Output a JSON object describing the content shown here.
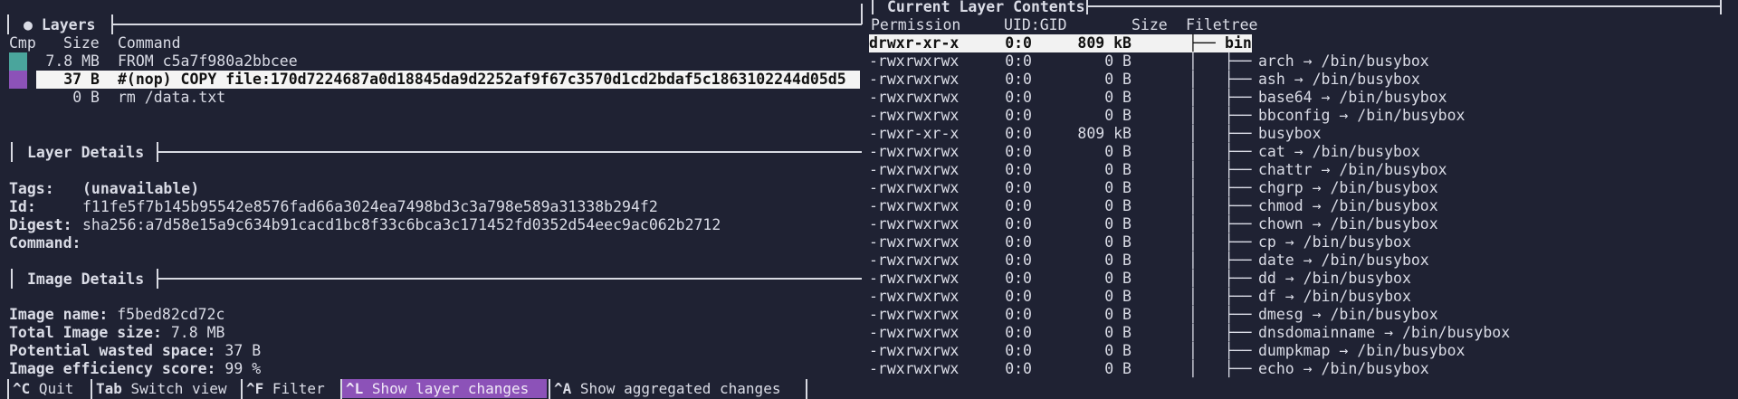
{
  "layers_panel": {
    "title": "● Layers",
    "headers": {
      "cmp": "Cmp",
      "size": "Size",
      "command": "Command"
    },
    "rows": [
      {
        "size": "7.8 MB",
        "command": "FROM c5a7f980a2bbcee",
        "cmp_color": "#4aa59c",
        "selected": false
      },
      {
        "size": "37 B",
        "command": "#(nop) COPY file:170d7224687a0d18845da9d2252af9f67c3570d1cd2bdaf5c1863102244d05d5",
        "cmp_color": "#8c52b8",
        "selected": true
      },
      {
        "size": "0 B",
        "command": "rm /data.txt",
        "cmp_color": "",
        "selected": false
      }
    ]
  },
  "layer_details": {
    "title": "Layer Details",
    "tags_label": "Tags:",
    "tags_value": "(unavailable)",
    "id_label": "Id:",
    "id_value": "f11fe5f7b145b95542e8576fad66a3024ea7498bd3c3a798e589a31338b294f2",
    "digest_label": "Digest:",
    "digest_value": "sha256:a7d58e15a9c634b91cacd1bc8f33c6bca3c171452fd0352d54eec9ac062b2712",
    "command_label": "Command:"
  },
  "image_details": {
    "title": "Image Details",
    "name_label": "Image name:",
    "name_value": "f5bed82cd72c",
    "size_label": "Total Image size:",
    "size_value": "7.8 MB",
    "wasted_label": "Potential wasted space:",
    "wasted_value": "37 B",
    "efficiency_label": "Image efficiency score:",
    "efficiency_value": "99 %"
  },
  "contents_panel": {
    "title": "Current Layer Contents",
    "headers": {
      "permission": "Permission",
      "uidgid": "UID:GID",
      "size": "Size",
      "filetree": "Filetree"
    },
    "rows": [
      {
        "perm": "drwxr-xr-x",
        "uid": "0:0",
        "size": "809 kB",
        "tree": "├── ",
        "name": "bin",
        "selected": true
      },
      {
        "perm": "-rwxrwxrwx",
        "uid": "0:0",
        "size": "0 B",
        "tree": "│   ├── ",
        "name": "arch → /bin/busybox",
        "selected": false
      },
      {
        "perm": "-rwxrwxrwx",
        "uid": "0:0",
        "size": "0 B",
        "tree": "│   ├── ",
        "name": "ash → /bin/busybox",
        "selected": false
      },
      {
        "perm": "-rwxrwxrwx",
        "uid": "0:0",
        "size": "0 B",
        "tree": "│   ├── ",
        "name": "base64 → /bin/busybox",
        "selected": false
      },
      {
        "perm": "-rwxrwxrwx",
        "uid": "0:0",
        "size": "0 B",
        "tree": "│   ├── ",
        "name": "bbconfig → /bin/busybox",
        "selected": false
      },
      {
        "perm": "-rwxr-xr-x",
        "uid": "0:0",
        "size": "809 kB",
        "tree": "│   ├── ",
        "name": "busybox",
        "selected": false
      },
      {
        "perm": "-rwxrwxrwx",
        "uid": "0:0",
        "size": "0 B",
        "tree": "│   ├── ",
        "name": "cat → /bin/busybox",
        "selected": false
      },
      {
        "perm": "-rwxrwxrwx",
        "uid": "0:0",
        "size": "0 B",
        "tree": "│   ├── ",
        "name": "chattr → /bin/busybox",
        "selected": false
      },
      {
        "perm": "-rwxrwxrwx",
        "uid": "0:0",
        "size": "0 B",
        "tree": "│   ├── ",
        "name": "chgrp → /bin/busybox",
        "selected": false
      },
      {
        "perm": "-rwxrwxrwx",
        "uid": "0:0",
        "size": "0 B",
        "tree": "│   ├── ",
        "name": "chmod → /bin/busybox",
        "selected": false
      },
      {
        "perm": "-rwxrwxrwx",
        "uid": "0:0",
        "size": "0 B",
        "tree": "│   ├── ",
        "name": "chown → /bin/busybox",
        "selected": false
      },
      {
        "perm": "-rwxrwxrwx",
        "uid": "0:0",
        "size": "0 B",
        "tree": "│   ├── ",
        "name": "cp → /bin/busybox",
        "selected": false
      },
      {
        "perm": "-rwxrwxrwx",
        "uid": "0:0",
        "size": "0 B",
        "tree": "│   ├── ",
        "name": "date → /bin/busybox",
        "selected": false
      },
      {
        "perm": "-rwxrwxrwx",
        "uid": "0:0",
        "size": "0 B",
        "tree": "│   ├── ",
        "name": "dd → /bin/busybox",
        "selected": false
      },
      {
        "perm": "-rwxrwxrwx",
        "uid": "0:0",
        "size": "0 B",
        "tree": "│   ├── ",
        "name": "df → /bin/busybox",
        "selected": false
      },
      {
        "perm": "-rwxrwxrwx",
        "uid": "0:0",
        "size": "0 B",
        "tree": "│   ├── ",
        "name": "dmesg → /bin/busybox",
        "selected": false
      },
      {
        "perm": "-rwxrwxrwx",
        "uid": "0:0",
        "size": "0 B",
        "tree": "│   ├── ",
        "name": "dnsdomainname → /bin/busybox",
        "selected": false
      },
      {
        "perm": "-rwxrwxrwx",
        "uid": "0:0",
        "size": "0 B",
        "tree": "│   ├── ",
        "name": "dumpkmap → /bin/busybox",
        "selected": false
      },
      {
        "perm": "-rwxrwxrwx",
        "uid": "0:0",
        "size": "0 B",
        "tree": "│   ├── ",
        "name": "echo → /bin/busybox",
        "selected": false
      }
    ]
  },
  "statusbar": {
    "items": [
      {
        "key": "^C",
        "label": " Quit",
        "highlight": false
      },
      {
        "key": "Tab",
        "label": " Switch view",
        "highlight": false
      },
      {
        "key": "^F",
        "label": " Filter",
        "highlight": false
      },
      {
        "key": "^L",
        "label": " Show layer changes",
        "highlight": true
      },
      {
        "key": "^A",
        "label": " Show aggregated changes",
        "highlight": false
      }
    ]
  },
  "colors": {
    "background": "#1f2233",
    "accent": "#8c52b8",
    "teal": "#4aa59c"
  }
}
